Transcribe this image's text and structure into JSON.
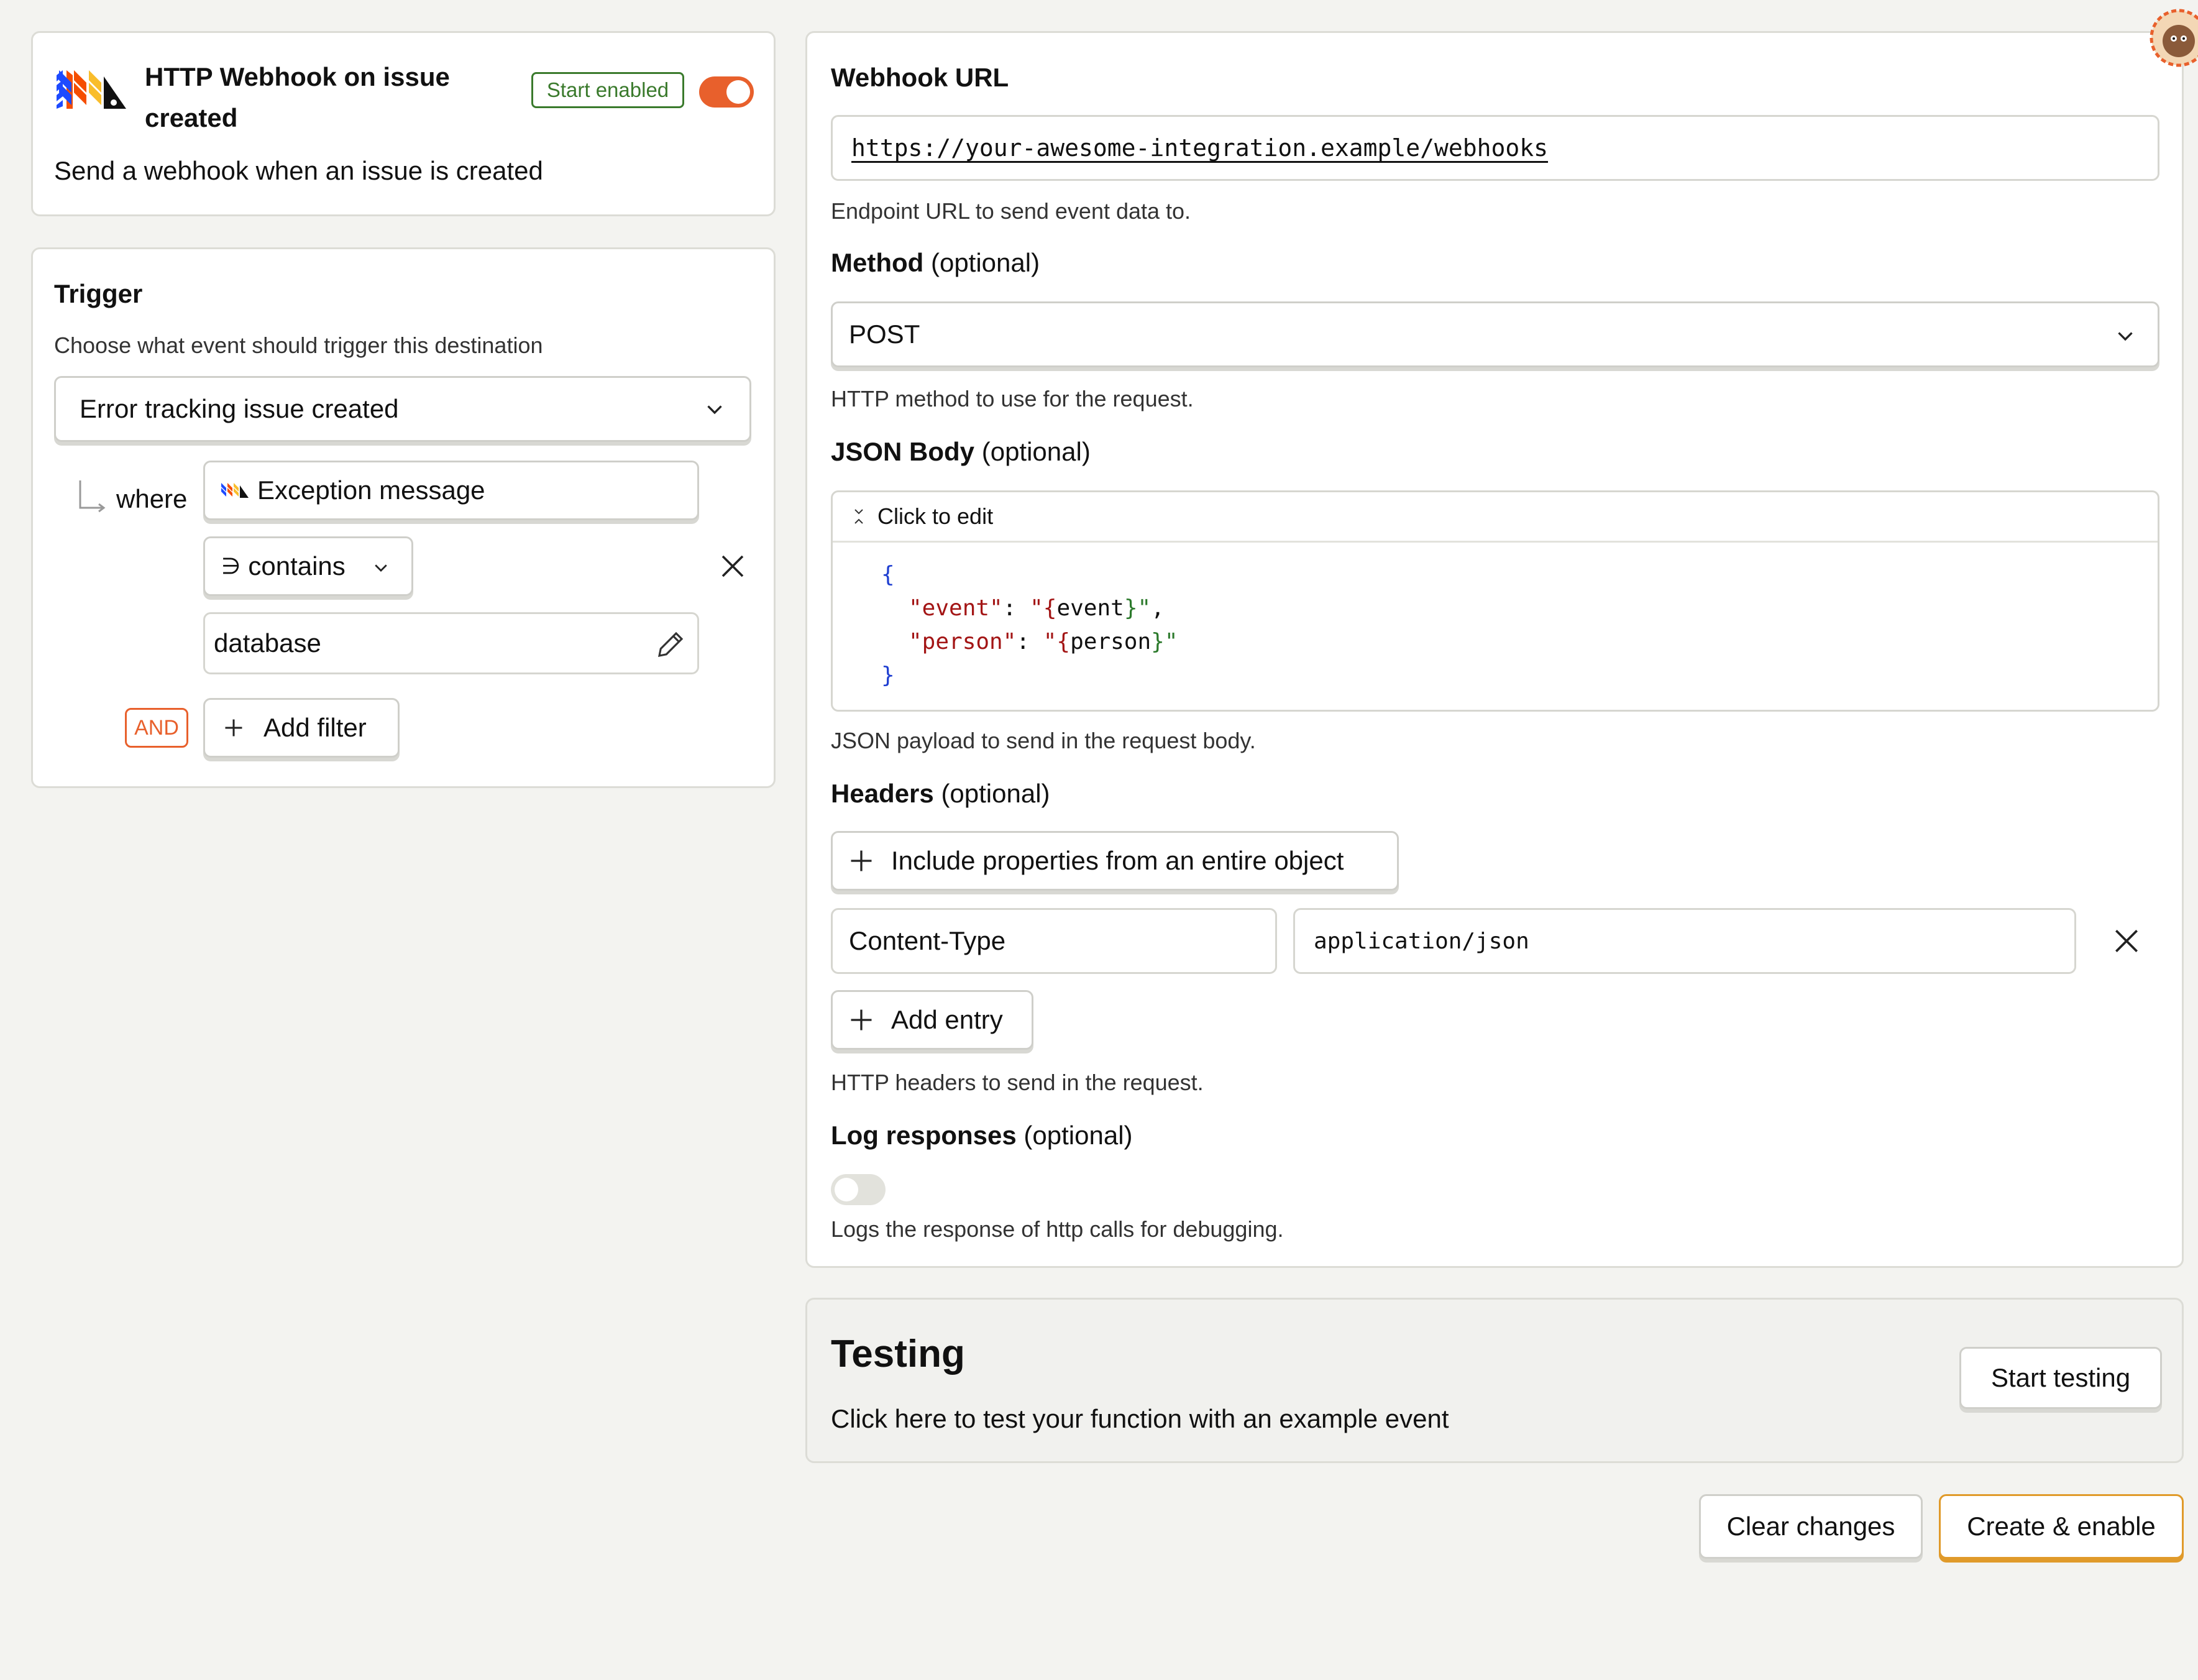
{
  "header": {
    "title_line1": "HTTP Webhook on issue",
    "title_line2": "created",
    "badge": "Start enabled",
    "description": "Send a webhook when an issue is created",
    "toggle_on": true
  },
  "trigger": {
    "title": "Trigger",
    "help": "Choose what event should trigger this destination",
    "event_select": "Error tracking issue created",
    "where_label": "where",
    "property": "Exception message",
    "operator_symbol": "∋",
    "operator": "contains",
    "value": "database",
    "and_label": "AND",
    "add_filter": "Add filter"
  },
  "webhook": {
    "url_label": "Webhook URL",
    "url_value": "https://your-awesome-integration.example/webhooks",
    "url_help": "Endpoint URL to send event data to.",
    "method_label": "Method",
    "optional": "(optional)",
    "method_value": "POST",
    "method_help": "HTTP method to use for the request.",
    "json_label": "JSON Body",
    "click_to_edit": "Click to edit",
    "json_lines": {
      "open": "{",
      "event_key": "\"event\"",
      "event_val_open": "\"{",
      "event_val": "event",
      "event_val_close": "}\"",
      "person_key": "\"person\"",
      "person_val_open": "\"{",
      "person_val": "person",
      "person_val_close": "}\"",
      "close": "}"
    },
    "json_help": "JSON payload to send in the request body.",
    "headers_label": "Headers",
    "include_props": "Include properties from an entire object",
    "header_key": "Content-Type",
    "header_value": "application/json",
    "add_entry": "Add entry",
    "headers_help": "HTTP headers to send in the request.",
    "log_label": "Log responses",
    "log_toggle_on": false,
    "log_help": "Logs the response of http calls for debugging."
  },
  "testing": {
    "title": "Testing",
    "description": "Click here to test your function with an example event",
    "start_button": "Start testing"
  },
  "footer": {
    "clear": "Clear changes",
    "create": "Create & enable"
  },
  "colors": {
    "accent": "#e8602c",
    "badge_green": "#3a7a2c",
    "json_key": "#a31515",
    "json_brace": "#1f3fd1",
    "json_interp": "#2c7a2c"
  }
}
